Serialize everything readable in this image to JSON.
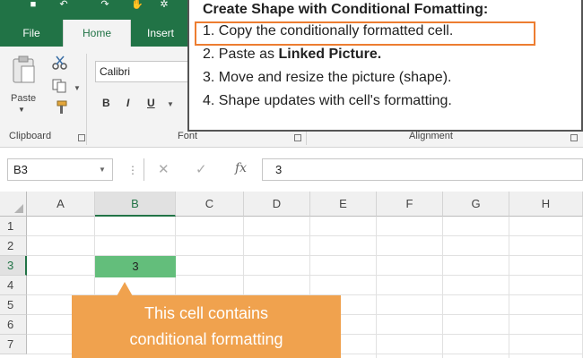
{
  "quick_access": {
    "save_icon": "save-icon",
    "undo_icon": "undo-icon",
    "redo_icon": "redo-icon",
    "touch_icon": "touch-mode-icon",
    "customize_icon": "customize-icon"
  },
  "tabs": [
    {
      "label": "File",
      "active": false
    },
    {
      "label": "Home",
      "active": true
    },
    {
      "label": "Insert",
      "active": false
    }
  ],
  "ribbon": {
    "paste_label": "Paste",
    "font_name": "Calibri",
    "bold": "B",
    "italic": "I",
    "underline": "U",
    "groups": {
      "clipboard": "Clipboard",
      "font": "Font",
      "alignment": "Alignment"
    }
  },
  "callout": {
    "title": "Create Shape with Conditional Fomatting:",
    "step1": "1. Copy the conditionally formatted cell.",
    "step2_prefix": "2. Paste as ",
    "step2_bold": "Linked Picture.",
    "step3": "3. Move and resize the picture (shape).",
    "step4": "4. Shape updates with cell's formatting.",
    "highlight_color": "#ed7d31"
  },
  "formula_bar": {
    "name_box": "B3",
    "fx_label": "fx",
    "value": "3"
  },
  "grid": {
    "columns": [
      "A",
      "B",
      "C",
      "D",
      "E",
      "F",
      "G",
      "H"
    ],
    "rows": [
      "1",
      "2",
      "3",
      "4",
      "5",
      "6",
      "7"
    ],
    "selected_column": "B",
    "selected_row": "3",
    "cell_b3_value": "3",
    "cell_b3_fill": "#63be7b"
  },
  "annotation": {
    "line1": "This cell contains",
    "line2": "conditional formatting",
    "color": "#f0a24e"
  },
  "colors": {
    "excel_green": "#217346"
  }
}
